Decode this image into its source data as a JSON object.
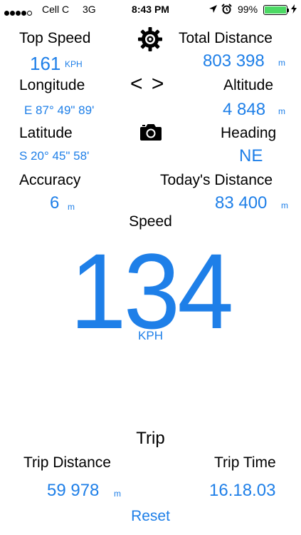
{
  "status_bar": {
    "carrier": "Cell C",
    "network": "3G",
    "time": "8:43 PM",
    "battery_percent": "99%",
    "signal_bars": 4,
    "icons": [
      "location-arrow-icon",
      "alarm-clock-icon",
      "battery-icon",
      "charging-bolt-icon"
    ]
  },
  "stats": {
    "top_speed": {
      "label": "Top Speed",
      "value": "161",
      "unit": "KPH"
    },
    "total_distance": {
      "label": "Total Distance",
      "value": "803 398",
      "unit": "m"
    },
    "longitude": {
      "label": "Longitude",
      "value": "E 87° 49\" 89'"
    },
    "altitude": {
      "label": "Altitude",
      "value": "4 848",
      "unit": "m"
    },
    "latitude": {
      "label": "Latitude",
      "value": "S 20° 45\" 58'"
    },
    "heading": {
      "label": "Heading",
      "value": "NE"
    },
    "accuracy": {
      "label": "Accuracy",
      "value": "6",
      "unit": "m"
    },
    "todays_distance": {
      "label": "Today's Distance",
      "value": "83 400",
      "unit": "m"
    }
  },
  "controls": {
    "settings_icon": "gear-icon",
    "nav_glyph": "< >",
    "camera_icon": "camera-icon"
  },
  "speed": {
    "label": "Speed",
    "value": "134",
    "unit": "KPH"
  },
  "trip": {
    "title": "Trip",
    "distance_label": "Trip Distance",
    "distance_value": "59 978",
    "distance_unit": "m",
    "time_label": "Trip Time",
    "time_value": "16.18.03",
    "reset_label": "Reset"
  },
  "colors": {
    "accent": "#1e7fe8",
    "battery": "#4cd964",
    "text": "#000000"
  }
}
